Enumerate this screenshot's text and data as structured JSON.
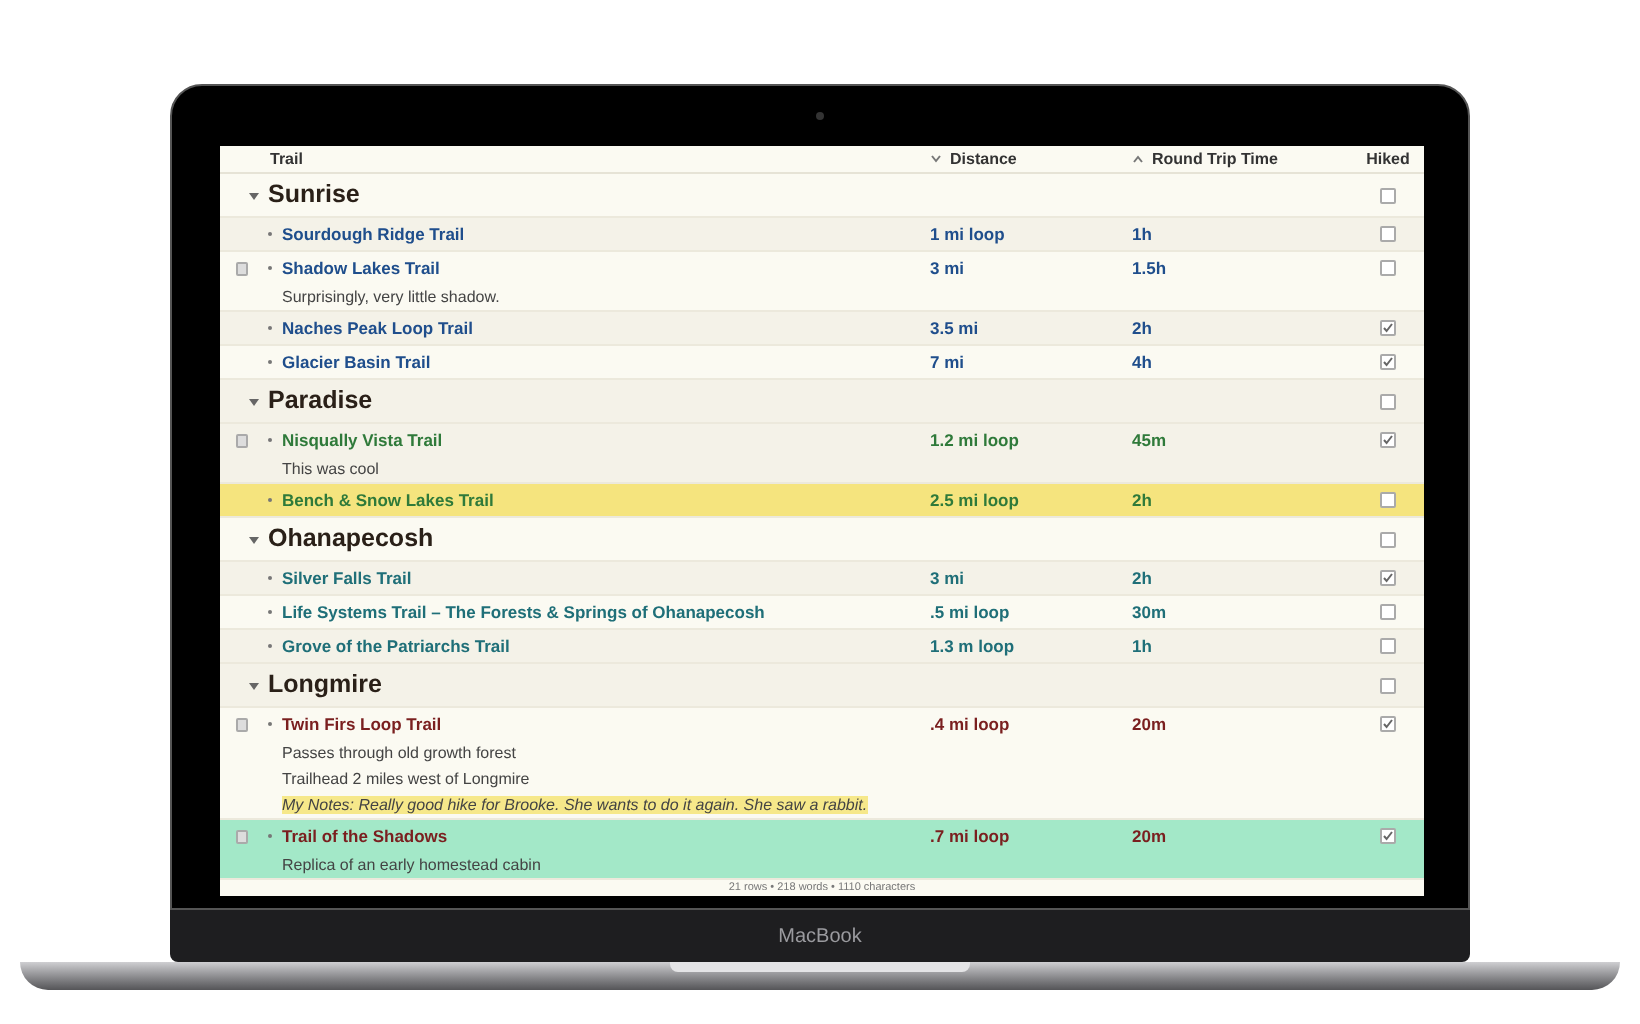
{
  "device": {
    "brand": "MacBook"
  },
  "table": {
    "columns": [
      {
        "label": "Trail"
      },
      {
        "label": "Distance",
        "sort_ascending": false
      },
      {
        "label": "Round Trip Time",
        "sort_ascending": true
      },
      {
        "label": "Hiked"
      }
    ],
    "groups": [
      {
        "name": "Sunrise",
        "expanded": true,
        "hiked": false,
        "color": "#1f4e8c",
        "children": [
          {
            "trail": "Sourdough Ridge Trail",
            "distance": "1 mi loop",
            "time": "1h",
            "hiked": false
          },
          {
            "trail": "Shadow Lakes Trail",
            "distance": "3 mi",
            "time": "1.5h",
            "hiked": false,
            "notes": [
              {
                "text": "Surprisingly, very little shadow.",
                "kind": "plain"
              }
            ]
          },
          {
            "trail": "Naches Peak Loop Trail",
            "distance": "3.5 mi",
            "time": "2h",
            "hiked": true
          },
          {
            "trail": "Glacier Basin Trail",
            "distance": "7 mi",
            "time": "4h",
            "hiked": true
          }
        ]
      },
      {
        "name": "Paradise",
        "expanded": true,
        "hiked": false,
        "color": "#2f7a3a",
        "children": [
          {
            "trail": "Nisqually Vista Trail",
            "distance": "1.2 mi loop",
            "time": "45m",
            "hiked": true,
            "notes": [
              {
                "text": "This was cool",
                "kind": "plain"
              }
            ]
          },
          {
            "trail": "Bench & Snow Lakes Trail",
            "distance": "2.5 mi loop",
            "time": "2h",
            "hiked": false,
            "color": "#f5e47e"
          }
        ]
      },
      {
        "name": "Ohanapecosh",
        "expanded": true,
        "hiked": false,
        "color": "#1f6f78",
        "children": [
          {
            "trail": "Silver Falls Trail",
            "distance": "3 mi",
            "time": "2h",
            "hiked": true
          },
          {
            "trail": "Life Systems Trail – The Forests & Springs of Ohanapecosh",
            "distance": ".5 mi loop",
            "time": "30m",
            "hiked": false
          },
          {
            "trail": "Grove of the Patriarchs Trail",
            "distance": "1.3 m loop",
            "time": "1h",
            "hiked": false
          }
        ]
      },
      {
        "name": "Longmire",
        "expanded": true,
        "hiked": false,
        "color": "#7a1f1f",
        "children": [
          {
            "trail": "Twin Firs Loop Trail",
            "distance": ".4 mi loop",
            "time": "20m",
            "hiked": true,
            "notes": [
              {
                "text": "Passes through old growth forest",
                "kind": "plain"
              },
              {
                "text": "Trailhead 2 miles west of Longmire",
                "kind": "plain"
              },
              {
                "text": "My Notes: Really good hike for Brooke. She wants to do it again. She saw a rabbit.",
                "kind": "highlight"
              }
            ]
          },
          {
            "trail": "Trail of the Shadows",
            "distance": ".7 mi loop",
            "time": "20m",
            "hiked": true,
            "color": "#a3e8c8",
            "notes": [
              {
                "text": "Replica of an early homestead cabin",
                "kind": "plain"
              }
            ]
          }
        ]
      }
    ]
  },
  "status_bar": "21 rows • 218 words • 1110 characters"
}
